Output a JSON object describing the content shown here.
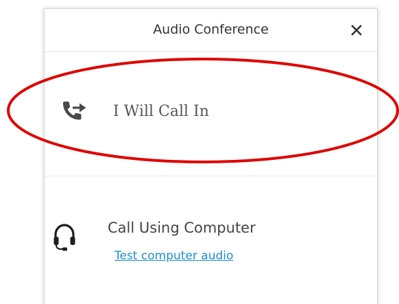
{
  "dialog": {
    "title": "Audio Conference",
    "close_icon": "close-icon"
  },
  "options": {
    "call_in": {
      "label": "I Will Call In",
      "icon": "phone-transfer-icon"
    },
    "computer": {
      "label": "Call Using Computer",
      "link": "Test computer audio",
      "icon": "headset-icon"
    }
  },
  "colors": {
    "annotation": "#e00000",
    "link": "#1a8fd6",
    "divider": "#e3e3e3"
  }
}
